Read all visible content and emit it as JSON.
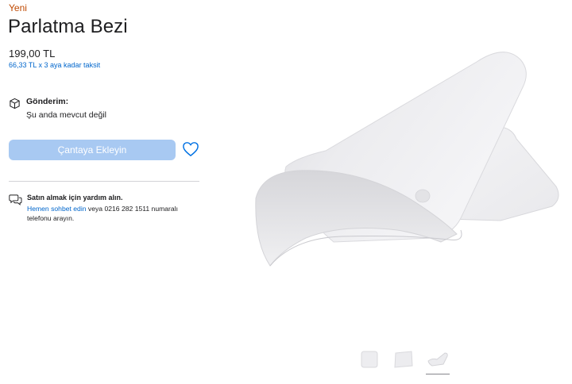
{
  "product": {
    "badge": "Yeni",
    "title": "Parlatma Bezi",
    "price": "199,00 TL",
    "installment": "66,33 TL x 3 aya kadar taksit"
  },
  "delivery": {
    "label": "Gönderim:",
    "status": "Şu anda mevcut değil",
    "icon": "box-icon"
  },
  "actions": {
    "add_to_bag": "Çantaya Ekleyin",
    "favorite_icon": "heart-icon"
  },
  "help": {
    "icon": "chat-bubbles-icon",
    "heading": "Satın almak için yardım alın.",
    "link_text": "Hemen sohbet edin",
    "body_text": " veya 0216 282 1511 numaralı telefonu arayın."
  },
  "gallery": {
    "thumbnails": [
      "cloth-flat-front",
      "cloth-flat-angle",
      "cloth-folded"
    ],
    "active_index": 2
  },
  "colors": {
    "badge": "#bf4800",
    "link": "#0066cc",
    "button_disabled": "#a8c9f2"
  }
}
